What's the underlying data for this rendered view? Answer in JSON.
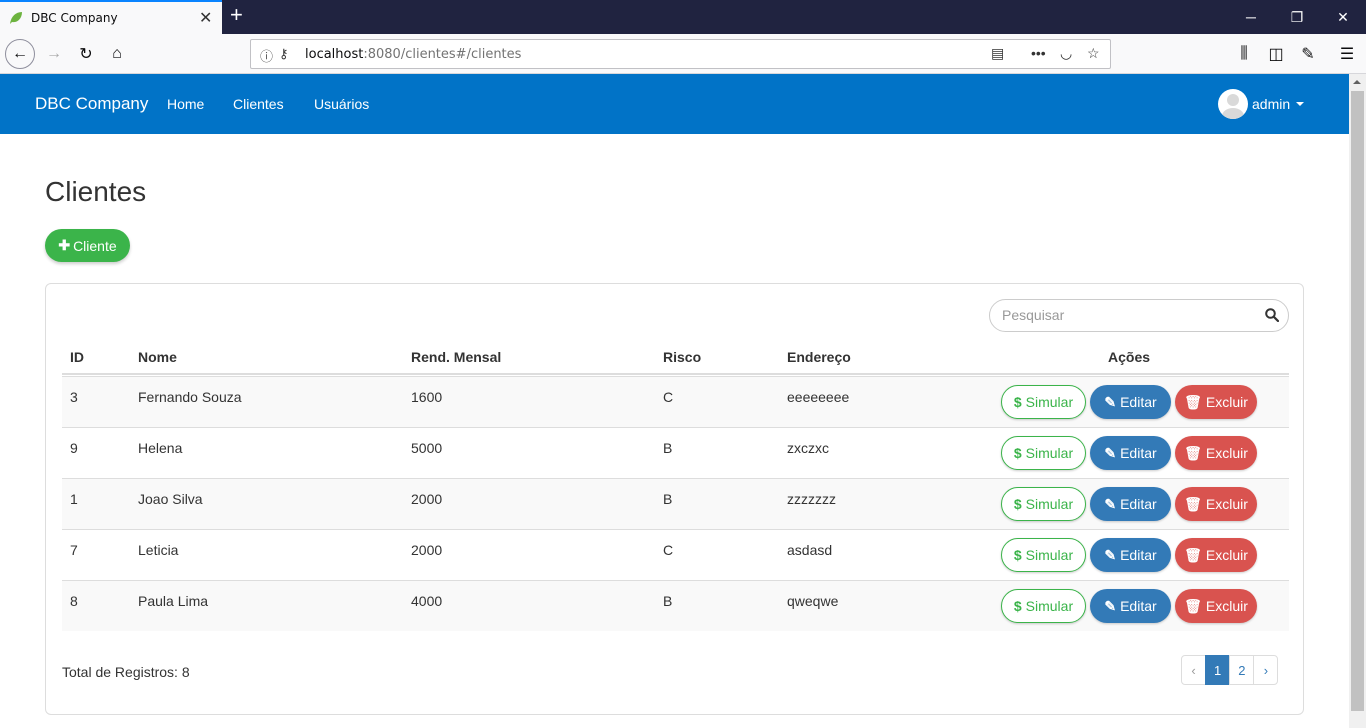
{
  "browser": {
    "tab_title": "DBC Company",
    "url_host": "localhost",
    "url_rest": ":8080/clientes#/clientes"
  },
  "app": {
    "brand": "DBC Company",
    "nav": [
      "Home",
      "Clientes",
      "Usuários"
    ],
    "user": "admin",
    "accent": "#0173c7"
  },
  "page": {
    "title": "Clientes",
    "add_button": "Cliente",
    "search_placeholder": "Pesquisar"
  },
  "table": {
    "headers": [
      "ID",
      "Nome",
      "Rend. Mensal",
      "Risco",
      "Endereço",
      "Ações"
    ],
    "rows": [
      {
        "id": "3",
        "nome": "Fernando Souza",
        "rend": "1600",
        "risco": "C",
        "endereco": "eeeeeeee"
      },
      {
        "id": "9",
        "nome": "Helena",
        "rend": "5000",
        "risco": "B",
        "endereco": "zxczxc"
      },
      {
        "id": "1",
        "nome": "Joao Silva",
        "rend": "2000",
        "risco": "B",
        "endereco": "zzzzzzz"
      },
      {
        "id": "7",
        "nome": "Leticia",
        "rend": "2000",
        "risco": "C",
        "endereco": "asdasd"
      },
      {
        "id": "8",
        "nome": "Paula Lima",
        "rend": "4000",
        "risco": "B",
        "endereco": "qweqwe"
      }
    ],
    "actions": {
      "simular": "Simular",
      "editar": "Editar",
      "excluir": "Excluir"
    }
  },
  "footer": {
    "total": "Total de Registros: 8",
    "pages": [
      "‹",
      "1",
      "2",
      "›"
    ],
    "active_page": "1"
  }
}
